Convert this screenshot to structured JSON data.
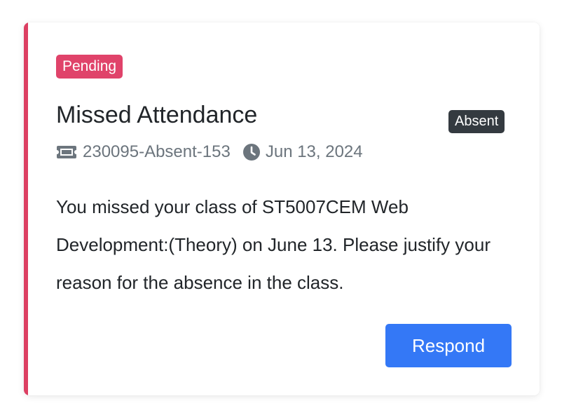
{
  "card": {
    "status": "Pending",
    "title": "Missed Attendance",
    "type_badge": "Absent",
    "ticket_id": "230095-Absent-153",
    "date": "Jun 13, 2024",
    "message": "You missed your class of ST5007CEM Web Development:(Theory) on June 13. Please justify your reason for the absence in the class.",
    "respond_label": "Respond",
    "icons": {
      "ticket": "ticket-icon",
      "date": "clock-icon"
    }
  },
  "colors": {
    "accent": "#dc3f62",
    "pending_badge": "#e0436a",
    "absent_badge": "#343a40",
    "primary_button": "#3478f6",
    "muted_text": "#6c757d"
  }
}
